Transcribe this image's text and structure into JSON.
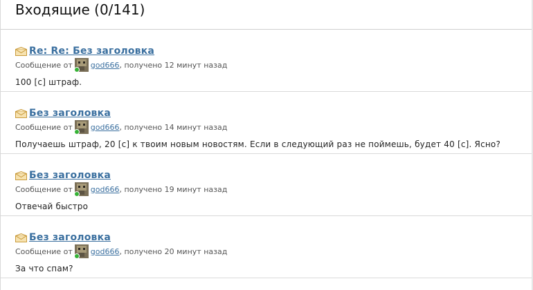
{
  "inbox": {
    "title": "Входящие (0/141)"
  },
  "messages": [
    {
      "subject": "Re: Re: Без заголовка",
      "from_prefix": "Сообщение от",
      "author": "god666",
      "received": ", получено 12 минут назад",
      "body": "100 [с] штраф."
    },
    {
      "subject": "Без заголовка",
      "from_prefix": "Сообщение от",
      "author": "god666",
      "received": ", получено 14 минут назад",
      "body": "Получаешь штраф, 20 [с] к твоим новым новостям. Если в следующий раз не поймешь, будет 40 [с]. Ясно?"
    },
    {
      "subject": "Без заголовка",
      "from_prefix": "Сообщение от",
      "author": "god666",
      "received": ", получено 19 минут назад",
      "body": "Отвечай быстро"
    },
    {
      "subject": "Без заголовка",
      "from_prefix": "Сообщение от",
      "author": "god666",
      "received": ", получено 20 минут назад",
      "body": "За что спам?"
    }
  ],
  "icons": {
    "message": "envelope-icon",
    "avatar": "user-avatar",
    "status": "online-status-dot"
  },
  "colors": {
    "link": "#3a6f9f",
    "online": "#36b336",
    "envelope": "#e8b54a"
  }
}
